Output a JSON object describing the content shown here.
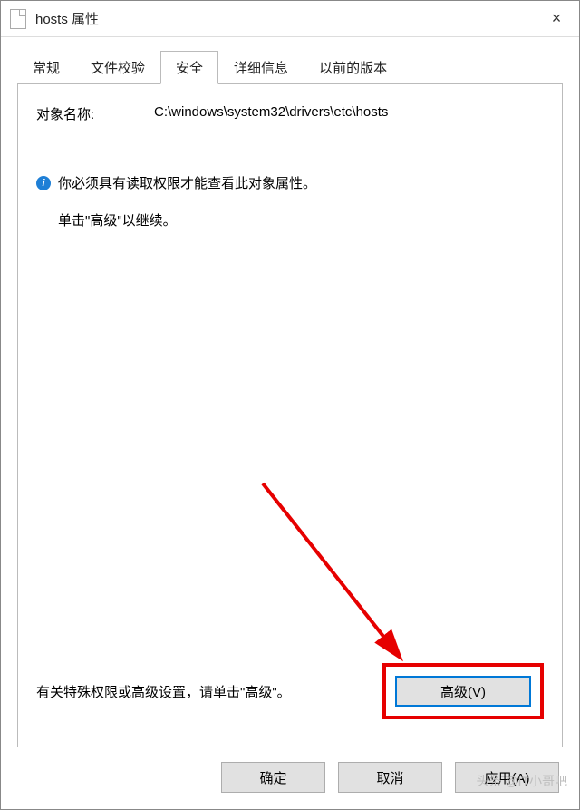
{
  "titlebar": {
    "title": "hosts 属性",
    "close_label": "×"
  },
  "tabs": [
    {
      "label": "常规"
    },
    {
      "label": "文件校验"
    },
    {
      "label": "安全"
    },
    {
      "label": "详细信息"
    },
    {
      "label": "以前的版本"
    }
  ],
  "active_tab_index": 2,
  "security": {
    "object_name_label": "对象名称:",
    "object_name_value": "C:\\windows\\system32\\drivers\\etc\\hosts",
    "info_icon": "i",
    "info_text": "你必须具有读取权限才能查看此对象属性。",
    "info_sub": "单击\"高级\"以继续。",
    "advanced_hint": "有关特殊权限或高级设置，请单击\"高级\"。",
    "advanced_button": "高级(V)"
  },
  "buttons": {
    "ok": "确定",
    "cancel": "取消",
    "apply": "应用(A)"
  },
  "watermark": "头条 @IT小哥吧"
}
